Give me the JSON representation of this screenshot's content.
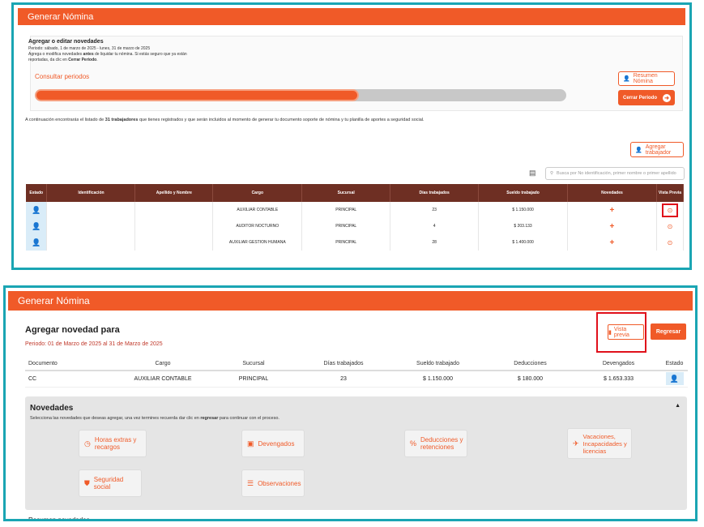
{
  "top": {
    "header_title": "Generar Nómina",
    "panel_title": "Agregar o editar novedades",
    "period_line": "Periodo: sábado, 1 de marzo de 2025 - lunes, 31 de marzo de 2025",
    "help_pre": "Agrega o modifica novedades ",
    "help_bold": "antes",
    "help_mid": " de liquidar tu nómina. Si estás seguro que ya están reportadas, da clic en ",
    "help_link": "Cerrar Periodo",
    "help_end": ".",
    "consult_label": "Consultar periodos",
    "progress_fraction": 0.61,
    "resumen_label": "Resumen Nómina",
    "cerrar_label": "Cerrar Periodo",
    "notice_pre": "A continuación encontrarás el listado de ",
    "notice_bold": "31 trabajadores",
    "notice_post": " que tienes registrados y que serán incluidos al momento de generar tu documento soporte de nómina y tu planilla de aportes a seguridad social.",
    "add_worker_label": "Agregar trabajador",
    "search_placeholder": "Busca por No identificación, primer nombre o primer apellido",
    "columns": [
      "Estado",
      "Identificación",
      "Apellido y Nombre",
      "Cargo",
      "Sucursal",
      "Días trabajados",
      "Sueldo trabajado",
      "Novedades",
      "Vista Previa"
    ],
    "rows": [
      {
        "identificacion": "",
        "nombre": "",
        "cargo": "AUXILIAR CONTABLE",
        "sucursal": "PRINCIPAL",
        "dias": "23",
        "sueldo": "$ 1.150.000"
      },
      {
        "identificacion": "",
        "nombre": "",
        "cargo": "AUDITOR NOCTURNO",
        "sucursal": "PRINCIPAL",
        "dias": "4",
        "sueldo": "$ 203.133"
      },
      {
        "identificacion": "",
        "nombre": "",
        "cargo": "AUXILIAR GESTION HUMANA",
        "sucursal": "PRINCIPAL",
        "dias": "28",
        "sueldo": "$ 1.400.000"
      }
    ]
  },
  "bottom": {
    "header_title": "Generar Nómina",
    "title": "Agregar novedad para",
    "period": "Periodo: 01 de Marzo de 2025 al 31 de Marzo de 2025",
    "vista_label": "Vista previa",
    "regresar_label": "Regresar",
    "columns": [
      "Documento",
      "Cargo",
      "Sucursal",
      "Días trabajados",
      "Sueldo trabajado",
      "Deducciones",
      "Devengados",
      "Estado"
    ],
    "row": {
      "documento": "CC",
      "cargo": "AUXILIAR CONTABLE",
      "sucursal": "PRINCIPAL",
      "dias": "23",
      "sueldo": "$ 1.150.000",
      "deducciones": "$ 180.000",
      "devengados": "$ 1.653.333"
    },
    "novedades_title": "Novedades",
    "novedades_desc_pre": "Selecciona las novedades que deseas agregar, una vez termines recuerda dar clic en ",
    "novedades_desc_bold": "regresar",
    "novedades_desc_post": " para continuar con el proceso.",
    "cards": {
      "horas": "Horas extras y recargos",
      "devengados": "Devengados",
      "deducciones": "Deducciones y retenciones",
      "vacaciones": "Vacaciones, Incapacidades y licencias",
      "seguridad": "Seguridad social",
      "observaciones": "Observaciones"
    },
    "cut_text": "Resumen novedades"
  }
}
